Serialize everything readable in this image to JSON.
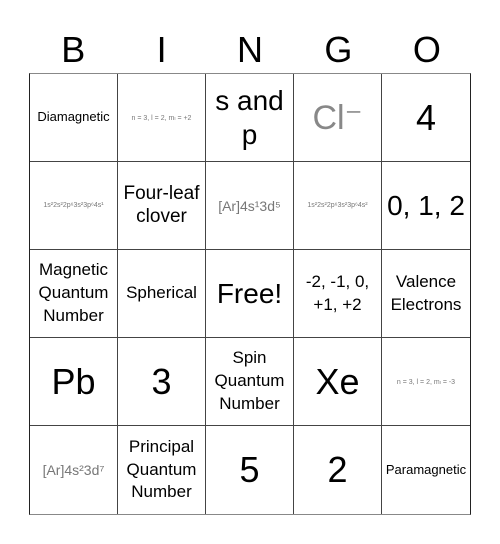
{
  "header": [
    "B",
    "I",
    "N",
    "G",
    "O"
  ],
  "cells": [
    {
      "text": "Diamagnetic",
      "size": "s-s"
    },
    {
      "text": "n = 3, l = 2, mₗ = +2",
      "size": "s-xs"
    },
    {
      "text": "s and p",
      "size": "s-l"
    },
    {
      "text": "Cl⁻",
      "size": "s-ion"
    },
    {
      "text": "4",
      "size": "s-xl"
    },
    {
      "text": "1s²2s²2p⁶3s²3p⁶4s¹",
      "size": "s-xs"
    },
    {
      "text": "Four-leaf clover",
      "size": "s-m"
    },
    {
      "text": "[Ar]4s¹3d⁵",
      "size": "s-img"
    },
    {
      "text": "1s²2s²2p⁶3s²3p⁶4s²",
      "size": "s-xs"
    },
    {
      "text": "0, 1, 2",
      "size": "s-l"
    },
    {
      "text": "Magnetic Quantum Number",
      "size": "s-n"
    },
    {
      "text": "Spherical",
      "size": "s-n"
    },
    {
      "text": "Free!",
      "size": "s-l"
    },
    {
      "text": "-2, -1, 0, +1, +2",
      "size": "s-n"
    },
    {
      "text": "Valence Electrons",
      "size": "s-n"
    },
    {
      "text": "Pb",
      "size": "s-xl"
    },
    {
      "text": "3",
      "size": "s-xl"
    },
    {
      "text": "Spin Quantum Number",
      "size": "s-n"
    },
    {
      "text": "Xe",
      "size": "s-xl"
    },
    {
      "text": "n = 3, l = 2, mₗ = -3",
      "size": "s-xs"
    },
    {
      "text": "[Ar]4s²3d⁷",
      "size": "s-img"
    },
    {
      "text": "Principal Quantum Number",
      "size": "s-n"
    },
    {
      "text": "5",
      "size": "s-xl"
    },
    {
      "text": "2",
      "size": "s-xl"
    },
    {
      "text": "Paramagnetic",
      "size": "s-s"
    }
  ]
}
